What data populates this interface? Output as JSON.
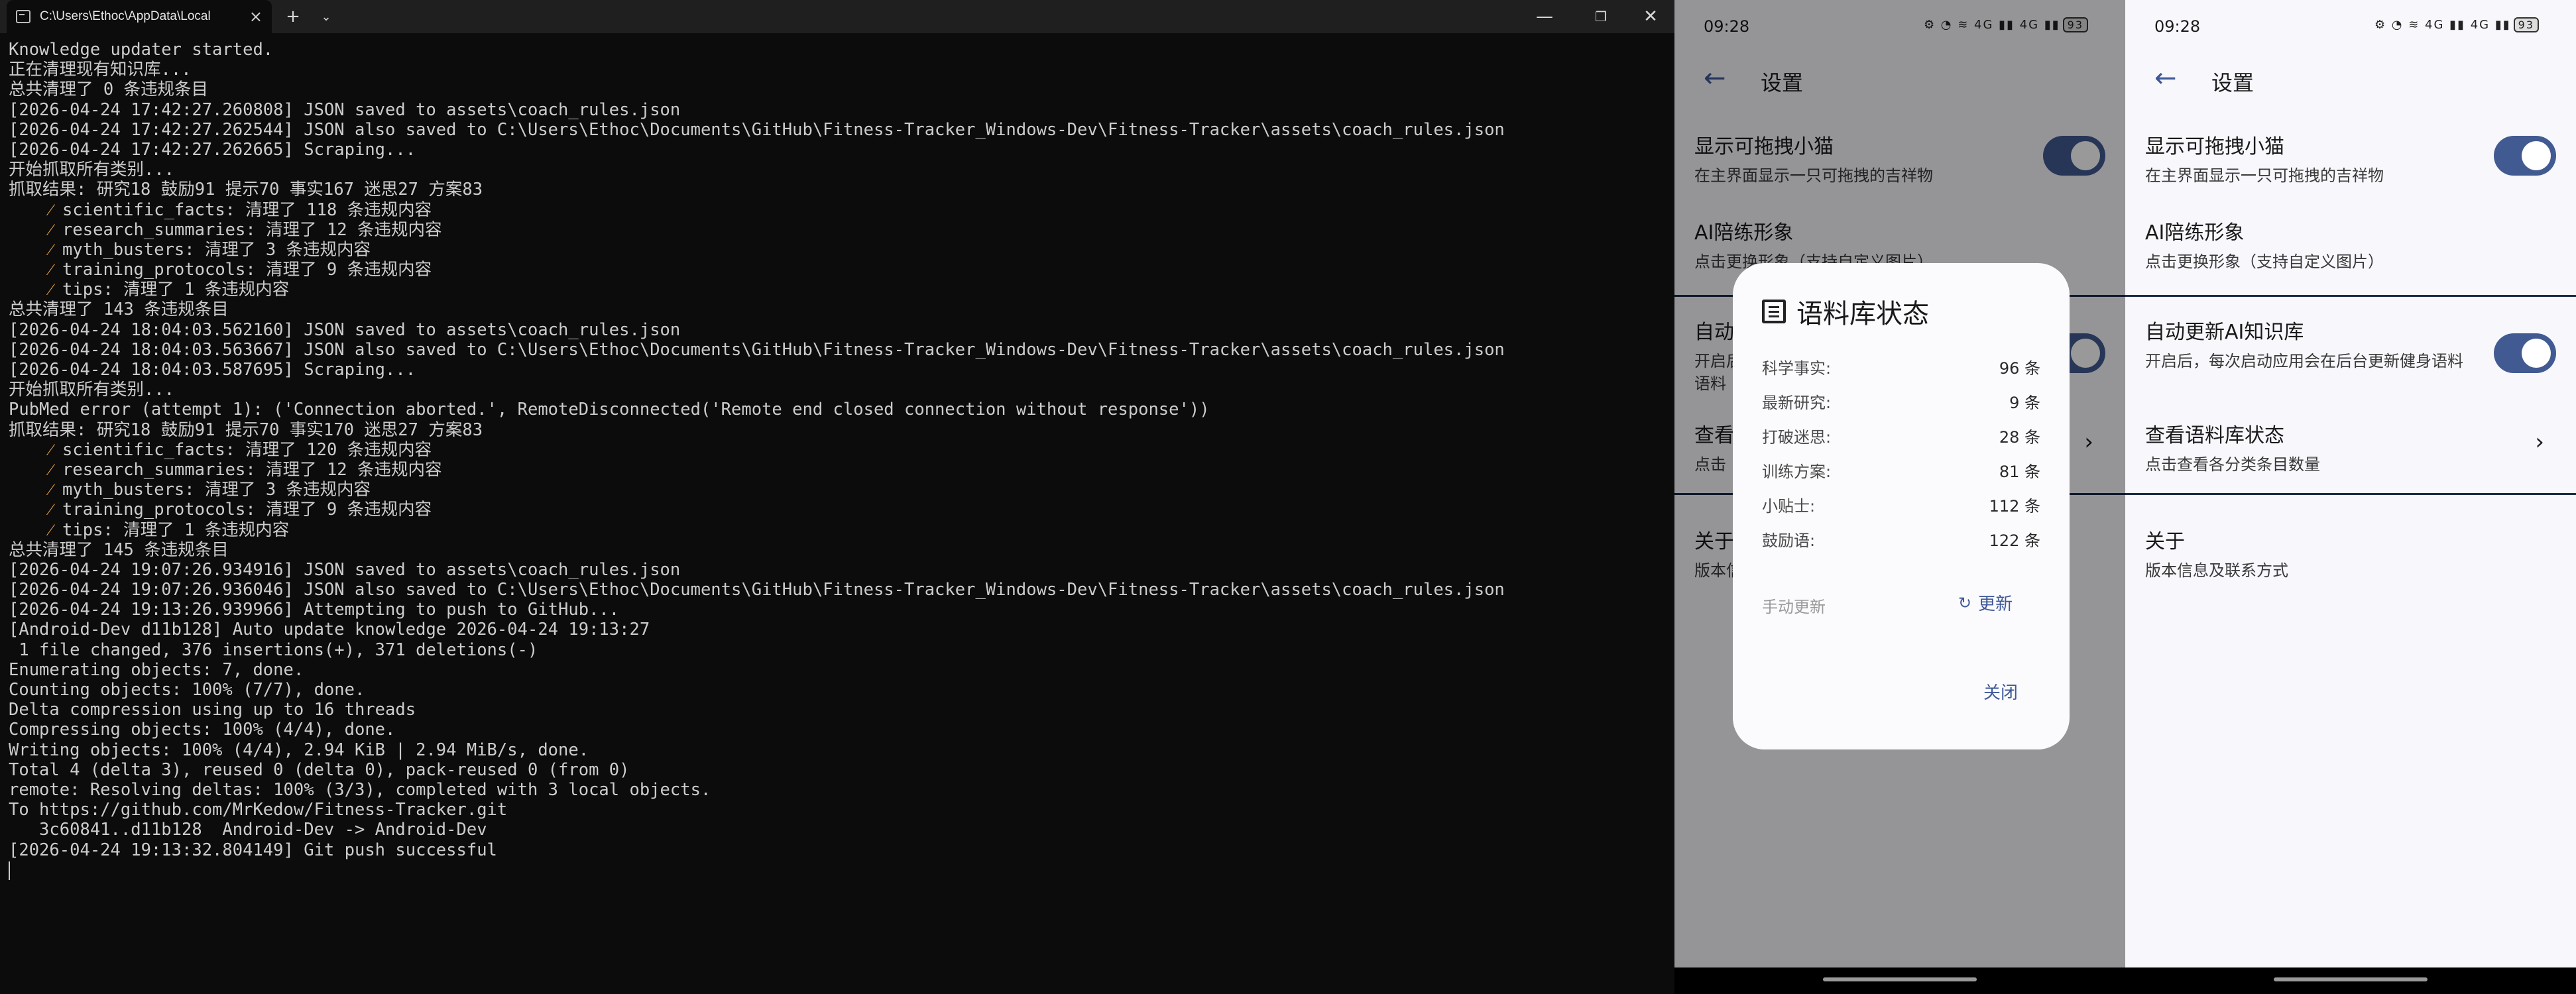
{
  "terminal": {
    "tab_title": "C:\\Users\\Ethoc\\AppData\\Local",
    "tab_close": "×",
    "new_tab": "+",
    "dropdown": "⌄",
    "minimize": "—",
    "maximize": "❐",
    "close": "✕",
    "lines": [
      "Knowledge updater started.",
      "正在清理现有知识库...",
      "总共清理了 0 条违规条目",
      "[2026-04-24 17:42:27.260808] JSON saved to assets\\coach_rules.json",
      "[2026-04-24 17:42:27.262544] JSON also saved to C:\\Users\\Ethoc\\Documents\\GitHub\\Fitness-Tracker_Windows-Dev\\Fitness-Tracker\\assets\\coach_rules.json",
      "[2026-04-24 17:42:27.262665] Scraping...",
      "开始抓取所有类别...",
      "抓取结果: 研究18 鼓励91 提示70 事实167 迷思27 方案83",
      "    scientific_facts: 清理了 118 条违规内容",
      "    research_summaries: 清理了 12 条违规内容",
      "    myth_busters: 清理了 3 条违规内容",
      "    training_protocols: 清理了 9 条违规内容",
      "    tips: 清理了 1 条违规内容",
      "总共清理了 143 条违规条目",
      "[2026-04-24 18:04:03.562160] JSON saved to assets\\coach_rules.json",
      "[2026-04-24 18:04:03.563667] JSON also saved to C:\\Users\\Ethoc\\Documents\\GitHub\\Fitness-Tracker_Windows-Dev\\Fitness-Tracker\\assets\\coach_rules.json",
      "[2026-04-24 18:04:03.587695] Scraping...",
      "开始抓取所有类别...",
      "PubMed error (attempt 1): ('Connection aborted.', RemoteDisconnected('Remote end closed connection without response'))",
      "抓取结果: 研究18 鼓励91 提示70 事实170 迷思27 方案83",
      "    scientific_facts: 清理了 120 条违规内容",
      "    research_summaries: 清理了 12 条违规内容",
      "    myth_busters: 清理了 3 条违规内容",
      "    training_protocols: 清理了 9 条违规内容",
      "    tips: 清理了 1 条违规内容",
      "总共清理了 145 条违规条目",
      "[2026-04-24 19:07:26.934916] JSON saved to assets\\coach_rules.json",
      "[2026-04-24 19:07:26.936046] JSON also saved to C:\\Users\\Ethoc\\Documents\\GitHub\\Fitness-Tracker_Windows-Dev\\Fitness-Tracker\\assets\\coach_rules.json",
      "[2026-04-24 19:13:26.939966] Attempting to push to GitHub...",
      "[Android-Dev d11b128] Auto update knowledge 2026-04-24 19:13:27",
      " 1 file changed, 376 insertions(+), 371 deletions(-)",
      "Enumerating objects: 7, done.",
      "Counting objects: 100% (7/7), done.",
      "Delta compression using up to 16 threads",
      "Compressing objects: 100% (4/4), done.",
      "Writing objects: 100% (4/4), 2.94 KiB | 2.94 MiB/s, done.",
      "Total 4 (delta 3), reused 0 (delta 0), pack-reused 0 (from 0)",
      "remote: Resolving deltas: 100% (3/3), completed with 3 local objects.",
      "To https://github.com/MrKedow/Fitness-Tracker.git",
      "   3c60841..d11b128  Android-Dev -> Android-Dev",
      "[2026-04-24 19:13:32.804149] Git push successful"
    ]
  },
  "phone": {
    "time": "09:28",
    "status_icons": "⚙ ◔ ≋ 4G ▮▮ 4G ▮▮",
    "battery": "93",
    "title": "设置",
    "items": [
      {
        "title": "显示可拖拽小猫",
        "subtitle": "在主界面显示一只可拖拽的吉祥物"
      },
      {
        "title": "AI陪练形象",
        "subtitle": "点击更换形象（支持自定义图片）"
      },
      {
        "title": "自动更新AI知识库",
        "subtitle": "开启后，每次启动应用会在后台更新健身语料"
      },
      {
        "title": "查看语料库状态",
        "subtitle": "点击查看各分类条目数量"
      },
      {
        "title": "关于",
        "subtitle": "版本信息及联系方式"
      }
    ],
    "dim_item_titles": [
      "显示可拖拽小猫",
      "AI陪练形象",
      "自动",
      "查看",
      "关于"
    ],
    "dim_item_subtitles": [
      "在主界面显示一只可拖拽的吉祥物",
      "点击更换形象（支持自定义图片）",
      "开启后",
      "语料",
      "点击",
      "版本信"
    ]
  },
  "dialog": {
    "title": "语料库状态",
    "rows": [
      {
        "label": "科学事实:",
        "value": "96 条"
      },
      {
        "label": "最新研究:",
        "value": "9 条"
      },
      {
        "label": "打破迷思:",
        "value": "28 条"
      },
      {
        "label": "训练方案:",
        "value": "81 条"
      },
      {
        "label": "小贴士:",
        "value": "112 条"
      },
      {
        "label": "鼓励语:",
        "value": "122 条"
      }
    ],
    "manual_label": "手动更新",
    "update_label": "更新",
    "close_label": "关闭"
  },
  "colors": {
    "accent": "#3e5898",
    "toggle_on": "#425a92",
    "terminal_bg": "#0c0c0c",
    "terminal_fg": "#cccccc"
  }
}
